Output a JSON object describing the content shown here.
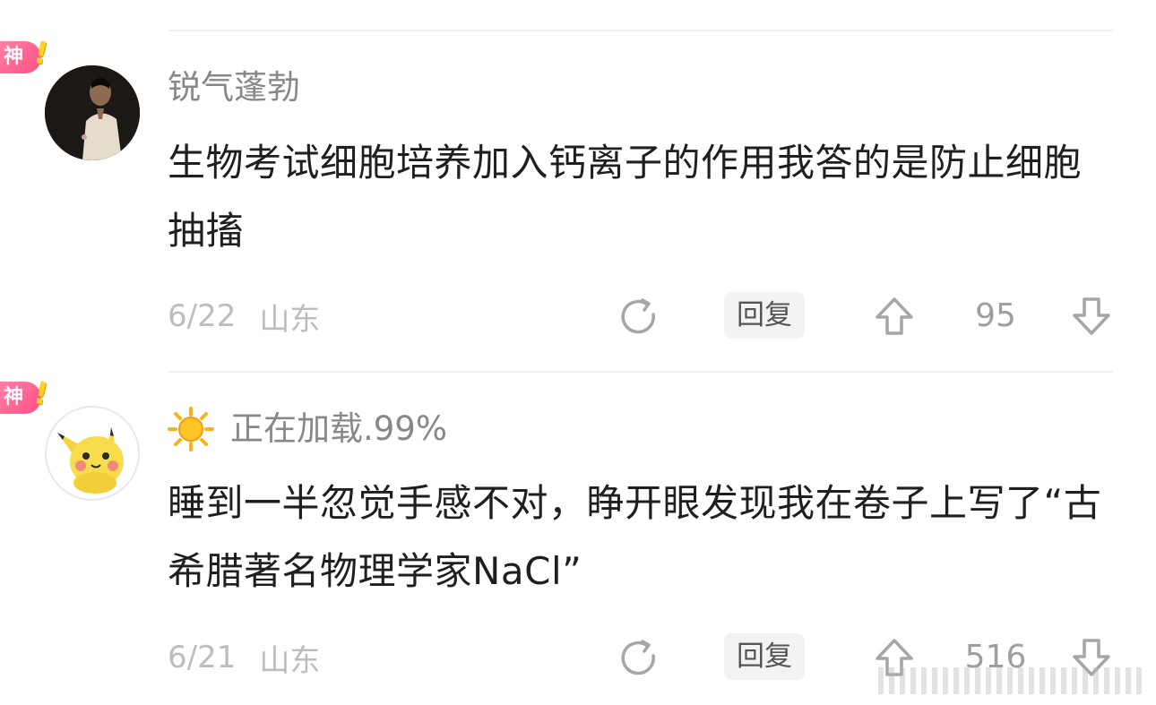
{
  "comments": [
    {
      "badge": "神",
      "badge_mark": "!",
      "username": "锐气蓬勃",
      "has_sun_icon": false,
      "text": "生物考试细胞培养加入钙离子的作用我答的是防止细胞抽搐",
      "date": "6/22",
      "location": "山东",
      "reply_label": "回复",
      "share_icon": "share-rotate-icon",
      "upvote_icon": "arrow-up-icon",
      "downvote_icon": "arrow-down-icon",
      "votes": "95"
    },
    {
      "badge": "神",
      "badge_mark": "!",
      "username": "正在加载.99%",
      "has_sun_icon": true,
      "text": "睡到一半忽觉手感不对，睁开眼发现我在卷子上写了“古希腊著名物理学家NaCl”",
      "date": "6/21",
      "location": "山东",
      "reply_label": "回复",
      "share_icon": "share-rotate-icon",
      "upvote_icon": "arrow-up-icon",
      "downvote_icon": "arrow-down-icon",
      "votes": "516"
    }
  ],
  "colors": {
    "badge_pink": "#ff5c8d",
    "badge_yellow": "#ffd21f",
    "username": "#888888",
    "content": "#1f1f1f",
    "meta": "#bdbdbd",
    "icon": "#a6a6a6",
    "divider": "#f1f1f1"
  }
}
